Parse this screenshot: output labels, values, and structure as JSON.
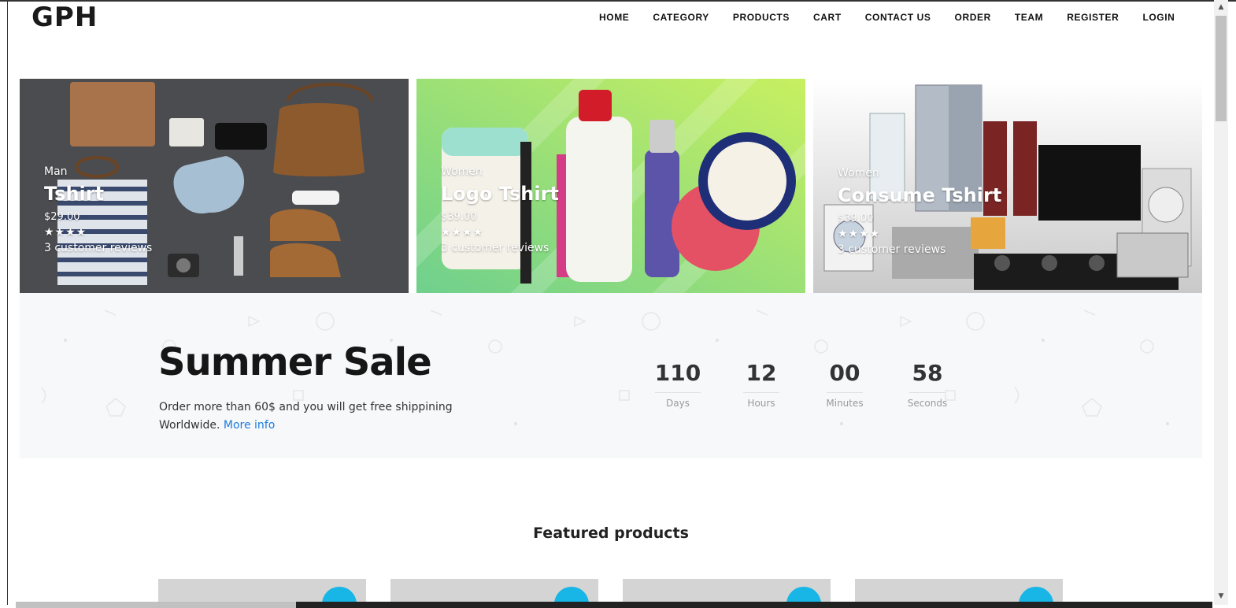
{
  "header": {
    "brand": "GPH",
    "nav": [
      "HOME",
      "CATEGORY",
      "PRODUCTS",
      "CART",
      "CONTACT US",
      "ORDER",
      "TEAM",
      "REGISTER",
      "LOGIN"
    ]
  },
  "hero": [
    {
      "category": "Man",
      "title": "Tshirt",
      "price": "$29.00",
      "stars": "★★★★",
      "reviews": "3 customer reviews"
    },
    {
      "category": "Women",
      "title": "Logo Tshirt",
      "price": "$39.00",
      "stars": "★★★★",
      "reviews": "3 customer reviews"
    },
    {
      "category": "Women",
      "title": "Consume Tshirt",
      "price": "$39.00",
      "stars": "★★★★",
      "reviews": "3 customer reviews"
    }
  ],
  "sale": {
    "title": "Summer Sale",
    "text": "Order more than 60$ and you will get free shippining Worldwide.",
    "link": "More info",
    "countdown": [
      {
        "value": "110",
        "label": "Days"
      },
      {
        "value": "12",
        "label": "Hours"
      },
      {
        "value": "00",
        "label": "Minutes"
      },
      {
        "value": "58",
        "label": "Seconds"
      }
    ]
  },
  "featured": {
    "title": "Featured products"
  },
  "colors": {
    "accent": "#17b6e6",
    "link": "#1c7ce0",
    "hero2_bg": "#7fd27a"
  }
}
